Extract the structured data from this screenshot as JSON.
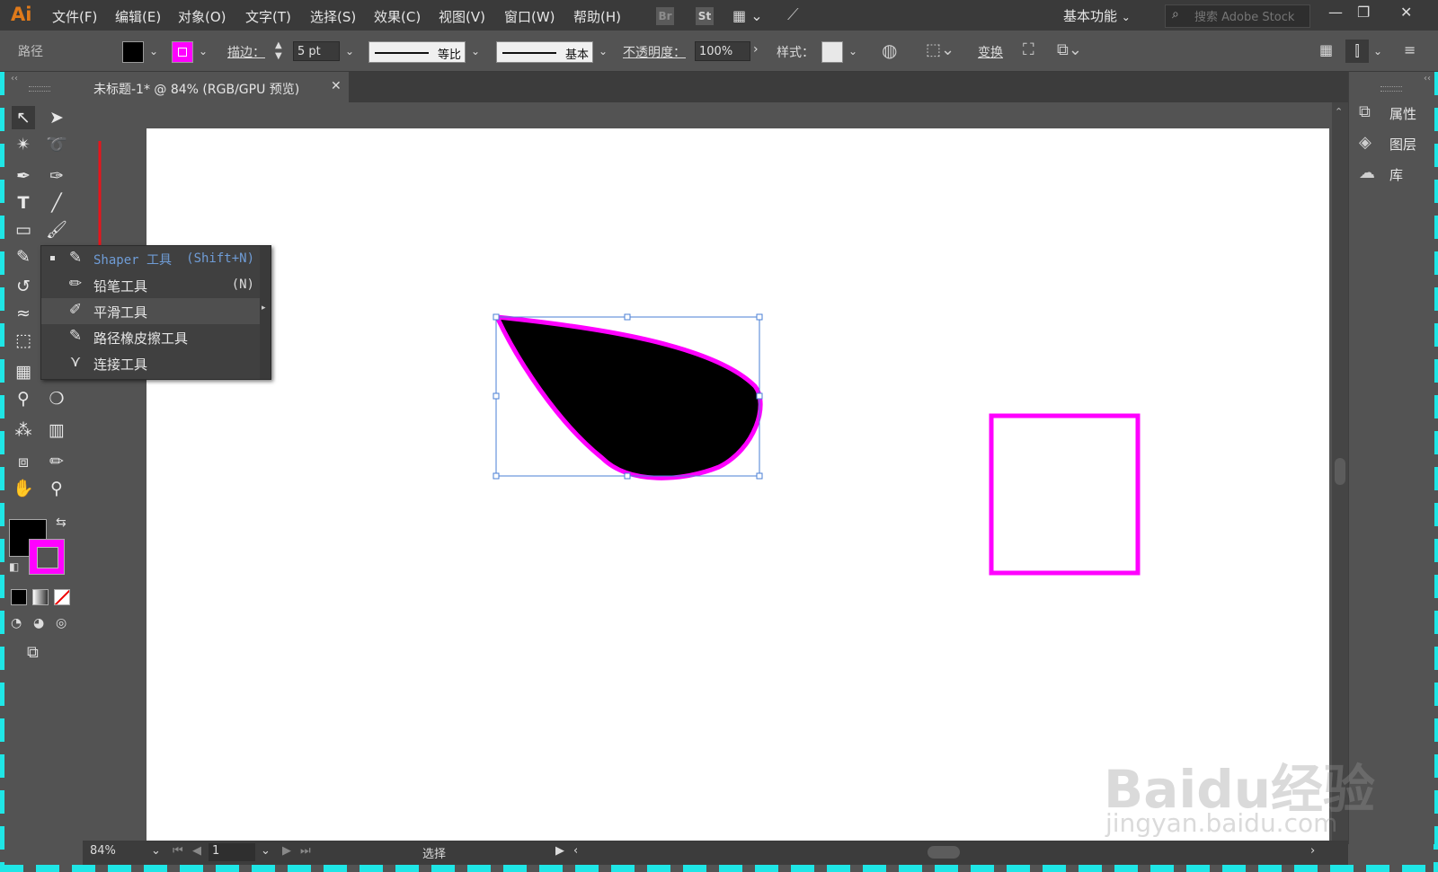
{
  "app": {
    "logo": "Ai"
  },
  "menu": [
    "文件(F)",
    "编辑(E)",
    "对象(O)",
    "文字(T)",
    "选择(S)",
    "效果(C)",
    "视图(V)",
    "窗口(W)",
    "帮助(H)"
  ],
  "bridge_badges": [
    "Br",
    "St"
  ],
  "workspace": "基本功能",
  "search": {
    "placeholder": "搜索 Adobe Stock"
  },
  "window_buttons": [
    "—",
    "❐",
    "✕"
  ],
  "control_bar": {
    "selection_type": "路径",
    "stroke_label": "描边：",
    "stroke_width": "5 pt",
    "profile_label": "等比",
    "brush_label": "基本",
    "opacity_label": "不透明度：",
    "opacity_value": "100%",
    "style_label": "样式：",
    "transform_label": "变换",
    "fill_color": "#000000",
    "stroke_color": "#ff00ff"
  },
  "document": {
    "tab_title": "未标题-1* @ 84% (RGB/GPU 预览)",
    "close": "✕"
  },
  "flyout": {
    "items": [
      {
        "label": "Shaper 工具",
        "shortcut": "(Shift+N)",
        "icon": "shaper-icon",
        "active": true
      },
      {
        "label": "铅笔工具",
        "shortcut": "(N)",
        "icon": "pencil-icon"
      },
      {
        "label": "平滑工具",
        "shortcut": "",
        "icon": "smooth-icon",
        "hover": true
      },
      {
        "label": "路径橡皮擦工具",
        "shortcut": "",
        "icon": "path-eraser-icon"
      },
      {
        "label": "连接工具",
        "shortcut": "",
        "icon": "join-icon"
      }
    ]
  },
  "panels": [
    {
      "label": "属性",
      "icon": "properties-icon"
    },
    {
      "label": "图层",
      "icon": "layers-icon"
    },
    {
      "label": "库",
      "icon": "libraries-icon"
    }
  ],
  "status": {
    "zoom": "84%",
    "artboard": "1",
    "tool": "选择"
  },
  "colors": {
    "accent_stroke": "#ff00ff",
    "selection": "#4a7fd6",
    "annotation_arrow": "#e8141b",
    "frame": "#1fe6e6"
  },
  "watermark": {
    "main": "Baidu经验",
    "sub": "jingyan.baidu.com"
  }
}
